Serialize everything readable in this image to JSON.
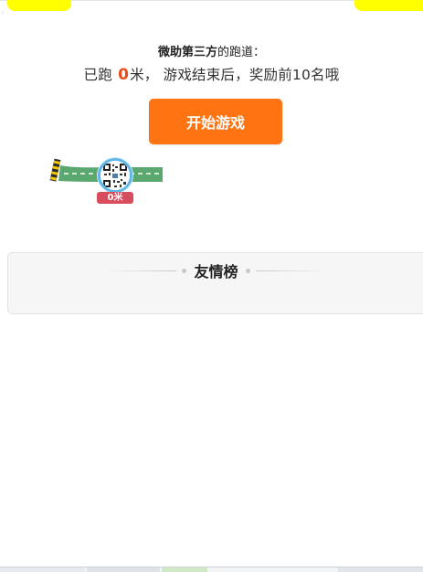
{
  "header": {
    "title_bold": "微助第三方",
    "title_rest": "的跑道：",
    "status_prefix": "已跑 ",
    "status_distance": "0",
    "status_suffix": "米， 游戏结束后，奖励前10名哦"
  },
  "actions": {
    "start_label": "开始游戏"
  },
  "track": {
    "runner_distance": "0米",
    "avatar_caption": "QR code avatar"
  },
  "ranking": {
    "title": "友情榜"
  },
  "colors": {
    "accent_orange": "#ff7412",
    "distance_red": "#e84c1b",
    "badge_red": "#d64d5d",
    "track_green": "#5aa86f",
    "corner_yellow": "#ffff00"
  }
}
